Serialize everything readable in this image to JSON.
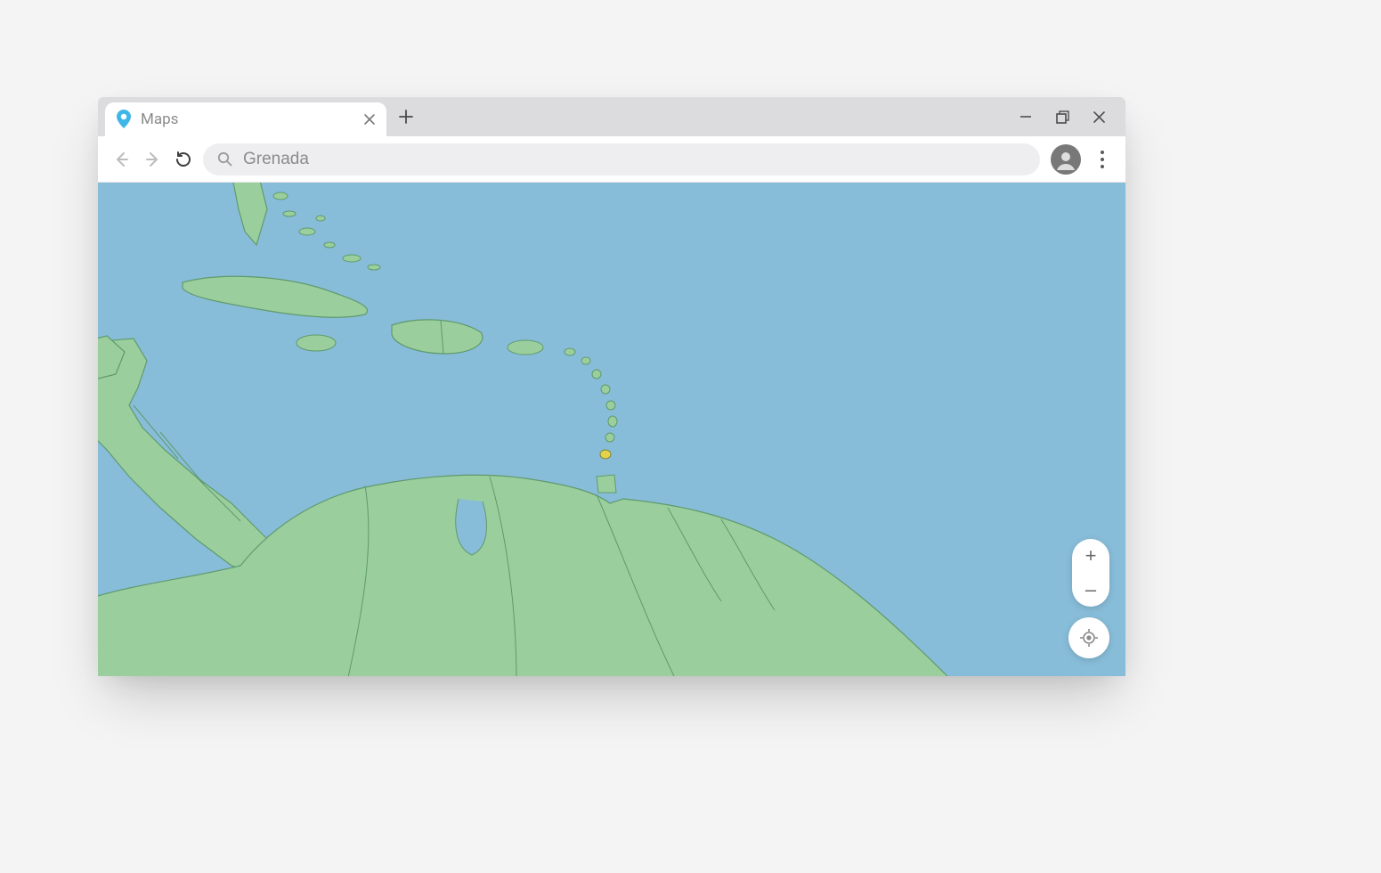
{
  "tab": {
    "title": "Maps"
  },
  "search": {
    "value": "Grenada"
  },
  "zoom": {
    "in": "+",
    "out": "–"
  },
  "map": {
    "region": "Caribbean",
    "highlighted_country": "Grenada",
    "water_color": "#88bdd9",
    "land_color": "#9bce9d",
    "border_color": "#5f9a6d",
    "highlight_color": "#e6d24a"
  }
}
